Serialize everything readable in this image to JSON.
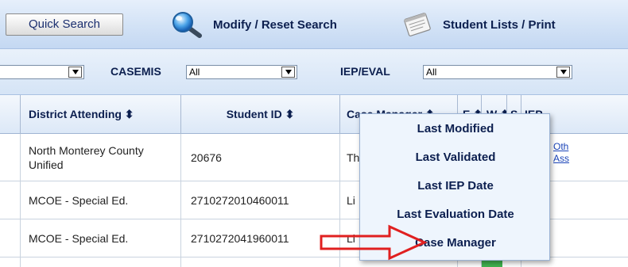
{
  "toolbar": {
    "quick_search_label": "Quick Search",
    "modify_label": "Modify / Reset Search",
    "lists_label": "Student Lists / Print"
  },
  "filters": {
    "casemis_label": "CASEMIS",
    "casemis_value": "All",
    "iep_label": "IEP/EVAL",
    "iep_value": "All",
    "left_value": ""
  },
  "table": {
    "headers": {
      "district": "District Attending ⬍",
      "student_id": "Student ID ⬍",
      "case_manager": "Case Manager ⬍",
      "e": "E ⬍",
      "w": "W ⬍",
      "s": "S",
      "iep": "IEP"
    },
    "rows": [
      {
        "district": "North Monterey County Unified",
        "student_id": "20676",
        "case_manager": "Th",
        "link1": "Oth",
        "link2": "Ass"
      },
      {
        "district": "MCOE - Special Ed.",
        "student_id": "2710272010460011",
        "case_manager": "Li"
      },
      {
        "district": "MCOE - Special Ed.",
        "student_id": "2710272041960011",
        "case_manager": "Li"
      }
    ]
  },
  "menu": {
    "items": [
      "Last Modified",
      "Last Validated",
      "Last IEP Date",
      "Last Evaluation Date",
      "Case Manager"
    ]
  },
  "colors": {
    "toolbar_bg": "#d2e2f6",
    "menu_bg": "#eef5fd",
    "arrow_red": "#e02020",
    "status_green": "#3fb34f"
  },
  "icons": {
    "modify": "magnifier-icon",
    "lists": "notepad-icon"
  }
}
